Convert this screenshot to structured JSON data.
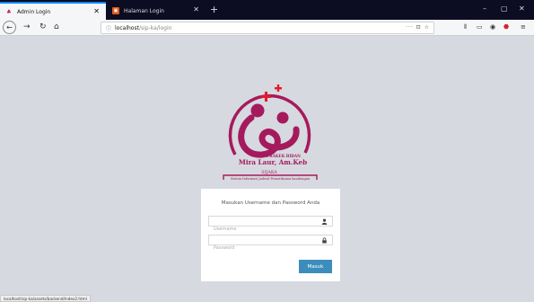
{
  "browser": {
    "tabs": [
      {
        "title": "Admin Login",
        "active": true
      },
      {
        "title": "Halaman Login",
        "active": false
      }
    ],
    "new_tab_icon": "plus-icon",
    "window_controls": {
      "minimize": "–",
      "maximize": "▢",
      "close": "✕"
    },
    "url": {
      "host": "localhost",
      "path": "/sip-ka/login",
      "suffix": "··· ⊡ ☆"
    },
    "status_url": "localhost/sip-ka/assets/backend/index2.html"
  },
  "logo": {
    "line1": "PRAKEK BIDAN",
    "line2": "Mira Laur, Am.Keb",
    "line3": "SIJAKA",
    "line4": "Sistem Informasi Jadwal Pemeriksaan kandungan",
    "colors": {
      "primary": "#a51a5c",
      "red": "#e3192c"
    }
  },
  "login": {
    "title": "Masukan Username dan Password Anda",
    "username_placeholder": "Username",
    "password_placeholder": "Password",
    "submit_label": "Masuk",
    "accent": "#3c8dbc"
  }
}
